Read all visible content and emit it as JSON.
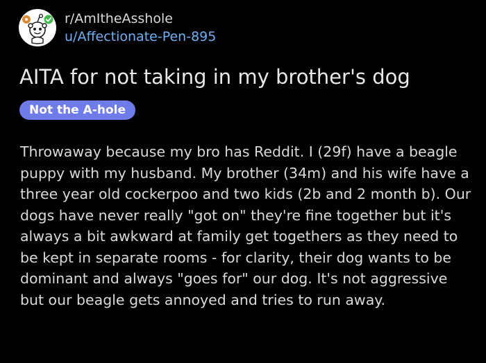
{
  "post": {
    "subreddit": "r/AmItheAsshole",
    "author": "u/Affectionate-Pen-895",
    "title": "AITA for not taking in my brother's dog",
    "flair": "Not the A-hole",
    "body": "Throwaway because my bro has Reddit. I (29f) have a beagle puppy with my husband. My brother (34m) and his wife have a three year old cockerpoo and two kids (2b and 2 month b). Our dogs have never really \"got on\" they're fine together but it's always a bit awkward at family get togethers as they need to be kept in separate rooms - for clarity, their dog wants to be dominant and always \"goes for\" our dog. It's not aggressive but our beagle gets annoyed and tries to run away."
  },
  "colors": {
    "background": "#000000",
    "text": "#d7dadc",
    "username": "#6cb0f5",
    "flair_bg": "#6f7be8",
    "badge_green": "#46b84f",
    "badge_orange": "#d98b3a"
  },
  "icons": {
    "avatar": "snoo-avatar-icon",
    "badge": "verified-check-icon"
  }
}
